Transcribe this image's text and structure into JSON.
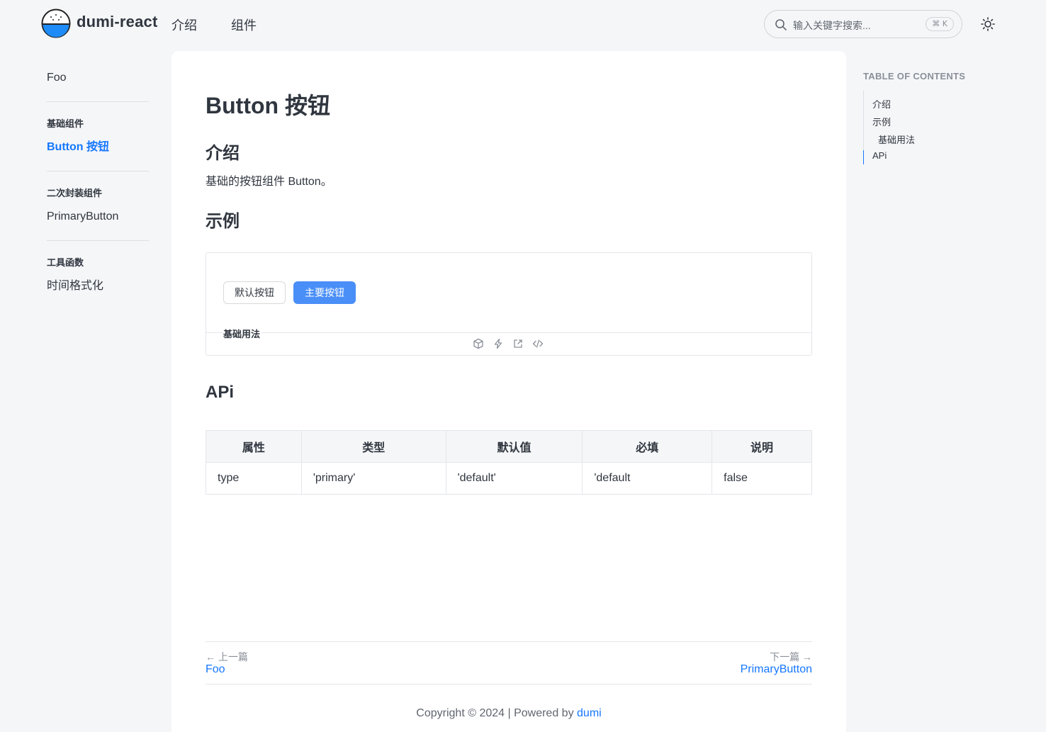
{
  "header": {
    "brand": "dumi-react",
    "nav": [
      "介绍",
      "组件"
    ],
    "search_placeholder": "输入关键字搜索...",
    "search_shortcut": "⌘ K"
  },
  "sidebar": {
    "top_link": "Foo",
    "groups": [
      {
        "title": "基础组件",
        "items": [
          "Button 按钮"
        ]
      },
      {
        "title": "二次封装组件",
        "items": [
          "PrimaryButton"
        ]
      },
      {
        "title": "工具函数",
        "items": [
          "时间格式化"
        ]
      }
    ]
  },
  "content": {
    "title": "Button 按钮",
    "intro_heading": "介绍",
    "intro_text": "基础的按钮组件 Button。",
    "example_heading": "示例",
    "demo": {
      "default_button": "默认按钮",
      "primary_button": "主要按钮",
      "title": "基础用法"
    },
    "api_heading": "APi",
    "api_table": {
      "headers": [
        "属性",
        "类型",
        "默认值",
        "必填",
        "说明"
      ],
      "rows": [
        [
          "type",
          "'primary'",
          "'default'",
          "'default",
          "false"
        ]
      ]
    },
    "pager": {
      "prev_label": "上一篇",
      "prev_title": "Foo",
      "next_label": "下一篇",
      "next_title": "PrimaryButton"
    },
    "footer": {
      "copyright": "Copyright © 2024 | Powered by",
      "link": "dumi"
    }
  },
  "toc": {
    "title": "TABLE OF CONTENTS",
    "items": [
      "介绍",
      "示例",
      "基础用法",
      "APi"
    ]
  },
  "colors": {
    "accent": "#1677ff",
    "primary_button": "#4a8ff7",
    "page_bg": "#f5f6f8"
  },
  "icons": [
    "dumi-logo-icon",
    "search-icon",
    "sun-icon",
    "codesandbox-icon",
    "stackblitz-icon",
    "open-external-icon",
    "code-icon",
    "arrow-left-icon",
    "arrow-right-icon"
  ]
}
